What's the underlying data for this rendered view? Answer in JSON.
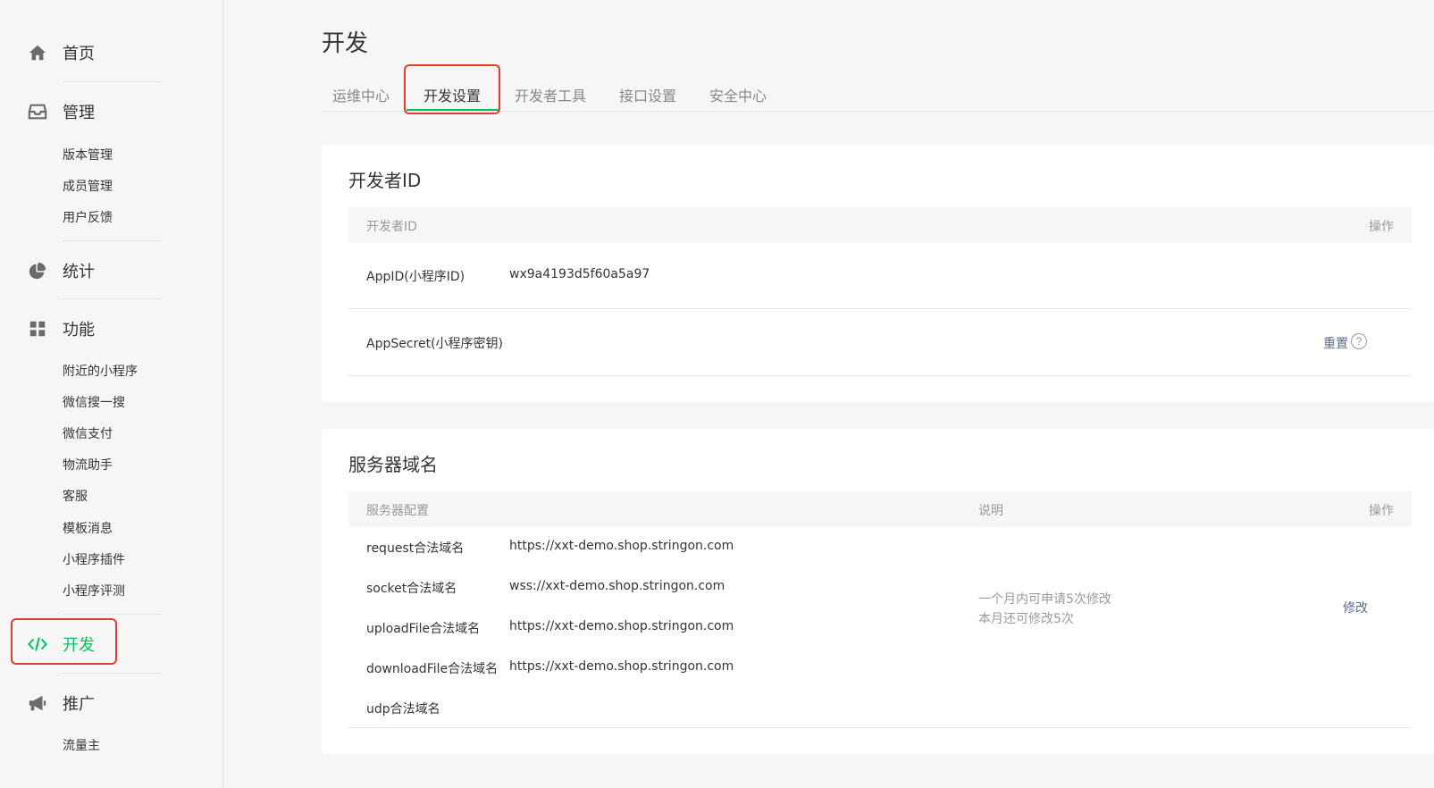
{
  "sidebar": {
    "home": "首页",
    "manage": {
      "label": "管理",
      "items": [
        "版本管理",
        "成员管理",
        "用户反馈"
      ]
    },
    "stats": "统计",
    "features": {
      "label": "功能",
      "items": [
        "附近的小程序",
        "微信搜一搜",
        "微信支付",
        "物流助手",
        "客服",
        "模板消息",
        "小程序插件",
        "小程序评测"
      ]
    },
    "develop": "开发",
    "promote": {
      "label": "推广",
      "items": [
        "流量主"
      ]
    }
  },
  "page": {
    "title": "开发",
    "tabs": [
      "运维中心",
      "开发设置",
      "开发者工具",
      "接口设置",
      "安全中心"
    ],
    "active_tab": "开发设置"
  },
  "developer_id": {
    "title": "开发者ID",
    "headers": {
      "name": "开发者ID",
      "action": "操作"
    },
    "rows": [
      {
        "name": "AppID(小程序ID)",
        "value": "wx9a4193d5f60a5a97"
      },
      {
        "name": "AppSecret(小程序密钥)",
        "value": "",
        "action": "重置",
        "help": "?"
      }
    ]
  },
  "server_domain": {
    "title": "服务器域名",
    "headers": {
      "config": "服务器配置",
      "desc": "说明",
      "action": "操作"
    },
    "rows": [
      {
        "name": "request合法域名",
        "value": "https://xxt-demo.shop.stringon.com"
      },
      {
        "name": "socket合法域名",
        "value": "wss://xxt-demo.shop.stringon.com"
      },
      {
        "name": "uploadFile合法域名",
        "value": "https://xxt-demo.shop.stringon.com"
      },
      {
        "name": "downloadFile合法域名",
        "value": "https://xxt-demo.shop.stringon.com"
      },
      {
        "name": "udp合法域名",
        "value": ""
      }
    ],
    "desc_line1": "一个月内可申请5次修改",
    "desc_line2": "本月还可修改5次",
    "action": "修改"
  },
  "colors": {
    "accent": "#07c160",
    "link": "#576b95",
    "highlight_box": "#e33e2b"
  }
}
